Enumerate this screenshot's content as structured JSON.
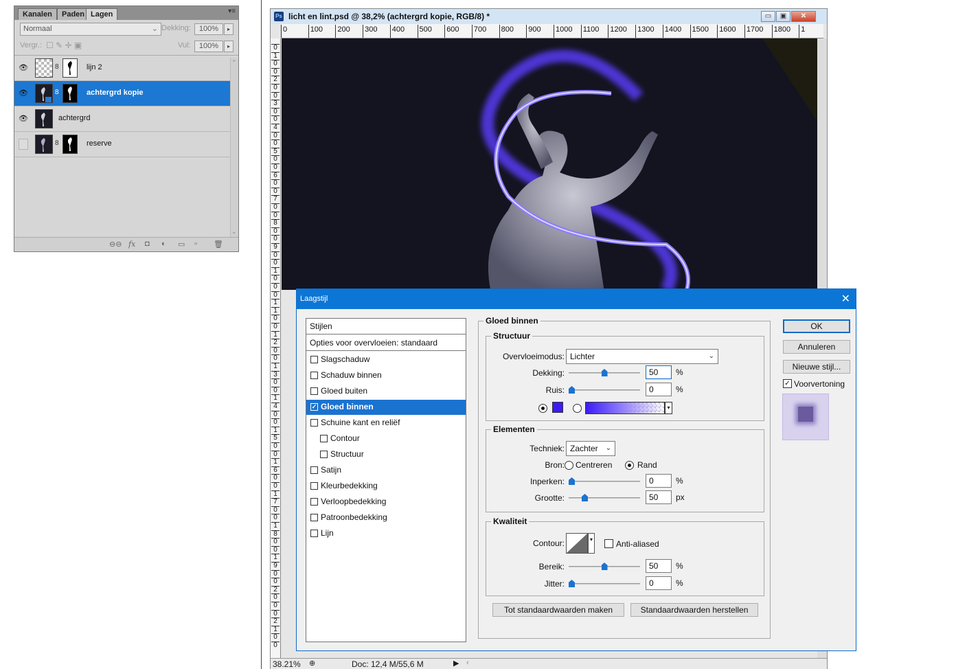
{
  "layers_panel": {
    "tabs": [
      "Kanalen",
      "Paden",
      "Lagen"
    ],
    "active_tab": "Lagen",
    "blend_mode": "Normaal",
    "opacity_label": "Dekking:",
    "opacity_value": "100%",
    "lock_label": "Vergr.:",
    "fill_label": "Vul:",
    "fill_value": "100%",
    "layers": [
      {
        "name": "lijn 2",
        "visible": true,
        "selected": false
      },
      {
        "name": "achtergrd kopie",
        "visible": true,
        "selected": true
      },
      {
        "name": "achtergrd",
        "visible": true,
        "selected": false
      },
      {
        "name": "reserve",
        "visible": false,
        "selected": false
      }
    ],
    "footer_icons": [
      "link-icon",
      "fx-icon",
      "mask-icon",
      "adjustment-icon",
      "group-icon",
      "new-layer-icon",
      "trash-icon"
    ]
  },
  "document": {
    "title": "licht en lint.psd @ 38,2% (achtergrd kopie, RGB/8) *",
    "ps_badge": "Ps",
    "ruler_h": [
      "0",
      "100",
      "200",
      "300",
      "400",
      "500",
      "600",
      "700",
      "800",
      "900",
      "1000",
      "1100",
      "1200",
      "1300",
      "1400",
      "1500",
      "1600",
      "1700",
      "1800",
      "1"
    ],
    "ruler_v": [
      "0",
      "1",
      "0",
      "0",
      "2",
      "0",
      "0",
      "3",
      "0",
      "0",
      "4",
      "0",
      "0",
      "5",
      "0",
      "0",
      "6",
      "0",
      "0",
      "7",
      "0",
      "0",
      "8",
      "0",
      "0",
      "9",
      "0",
      "0",
      "1",
      "0",
      "0",
      "0",
      "1",
      "1",
      "0",
      "0",
      "1",
      "2",
      "0",
      "0",
      "1",
      "3",
      "0",
      "0",
      "1",
      "4",
      "0",
      "0",
      "1",
      "5",
      "0",
      "0",
      "1",
      "6",
      "0",
      "0",
      "1",
      "7",
      "0",
      "0",
      "1",
      "8",
      "0",
      "0",
      "1",
      "9",
      "0",
      "0",
      "2",
      "0",
      "0",
      "0",
      "2",
      "1",
      "0",
      "0"
    ],
    "zoom": "38.21%",
    "doc_size": "Doc: 12,4 M/55,6 M"
  },
  "dialog": {
    "title": "Laagstijl",
    "styles_header": "Stijlen",
    "blend_options": "Opties voor overvloeien: standaard",
    "effects": [
      {
        "label": "Slagschaduw",
        "checked": false,
        "indent": false
      },
      {
        "label": "Schaduw binnen",
        "checked": false,
        "indent": false
      },
      {
        "label": "Gloed buiten",
        "checked": false,
        "indent": false
      },
      {
        "label": "Gloed binnen",
        "checked": true,
        "indent": false,
        "selected": true
      },
      {
        "label": "Schuine kant en reliëf",
        "checked": false,
        "indent": false
      },
      {
        "label": "Contour",
        "checked": false,
        "indent": true
      },
      {
        "label": "Structuur",
        "checked": false,
        "indent": true
      },
      {
        "label": "Satijn",
        "checked": false,
        "indent": false
      },
      {
        "label": "Kleurbedekking",
        "checked": false,
        "indent": false
      },
      {
        "label": "Verloopbedekking",
        "checked": false,
        "indent": false
      },
      {
        "label": "Patroonbedekking",
        "checked": false,
        "indent": false
      },
      {
        "label": "Lijn",
        "checked": false,
        "indent": false
      }
    ],
    "section_title": "Gloed binnen",
    "structure": {
      "title": "Structuur",
      "blend_label": "Overvloeimodus:",
      "blend_value": "Lichter",
      "opacity_label": "Dekking:",
      "opacity_value": "50",
      "opacity_unit": "%",
      "opacity_fraction": 0.5,
      "noise_label": "Ruis:",
      "noise_value": "0",
      "noise_unit": "%",
      "noise_fraction": 0,
      "glow_color": "#3b1cf5"
    },
    "elements": {
      "title": "Elementen",
      "technique_label": "Techniek:",
      "technique_value": "Zachter",
      "source_label": "Bron:",
      "source_center": "Centreren",
      "source_edge": "Rand",
      "choke_label": "Inperken:",
      "choke_value": "0",
      "choke_unit": "%",
      "choke_fraction": 0,
      "size_label": "Grootte:",
      "size_value": "50",
      "size_unit": "px",
      "size_fraction": 0.2
    },
    "quality": {
      "title": "Kwaliteit",
      "contour_label": "Contour:",
      "antialias_label": "Anti-aliased",
      "range_label": "Bereik:",
      "range_value": "50",
      "range_unit": "%",
      "range_fraction": 0.5,
      "jitter_label": "Jitter:",
      "jitter_value": "0",
      "jitter_unit": "%",
      "jitter_fraction": 0
    },
    "make_default": "Tot standaardwaarden maken",
    "reset_default": "Standaardwaarden herstellen",
    "ok": "OK",
    "cancel": "Annuleren",
    "new_style": "Nieuwe stijl...",
    "preview_label": "Voorvertoning"
  }
}
